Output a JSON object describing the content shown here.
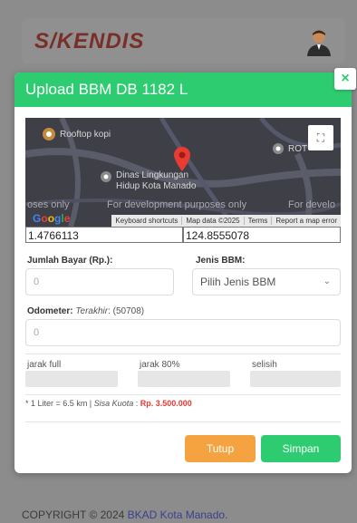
{
  "app": {
    "brand": "S/KENDIS",
    "footer_prefix": "COPYRIGHT © 2024",
    "footer_link": "BKAD Kota Manado."
  },
  "modal": {
    "title": "Upload BBM DB 1182 L",
    "close_symbol": "×"
  },
  "map": {
    "poi_1": "Rooftop kopi",
    "poi_2_line1": "Dinas Lingkungan",
    "poi_2_line2": "Hidup Kota Manado",
    "poi_3": "ROT",
    "dev_left": "oses only",
    "dev_center": "For development purposes only",
    "dev_right": "For develo",
    "attribution": [
      "Keyboard shortcuts",
      "Map data ©2025",
      "Terms",
      "Report a map error"
    ],
    "fullscreen_symbol": "⛶",
    "google": [
      "G",
      "o",
      "o",
      "g",
      "l",
      "e"
    ],
    "marker_color": "#ea3b33"
  },
  "coords": {
    "lat": "1.4766113",
    "lng": "124.8555078"
  },
  "form": {
    "amount_label": "Jumlah Bayar (Rp.):",
    "amount_placeholder": "0",
    "fuel_label": "Jenis BBM:",
    "fuel_selected": "Pilih Jenis BBM",
    "odometer_label": "Odometer:",
    "odometer_last_label": "Terakhir",
    "odometer_last_value": ": (50708)",
    "odometer_placeholder": "0",
    "jarak_full_label": "jarak full",
    "jarak_80_label": "jarak 80%",
    "selisih_label": "selisih"
  },
  "note": {
    "asterisk": "*",
    "ratio": "1 Liter = 6.5 km |",
    "quota_label": "Sisa Kuota",
    "quota_sep": ":",
    "quota_value": "Rp. 3.500.000"
  },
  "buttons": {
    "close": "Tutup",
    "save": "Simpan",
    "close_color": "#f4a340",
    "save_color": "#2ecc71"
  }
}
